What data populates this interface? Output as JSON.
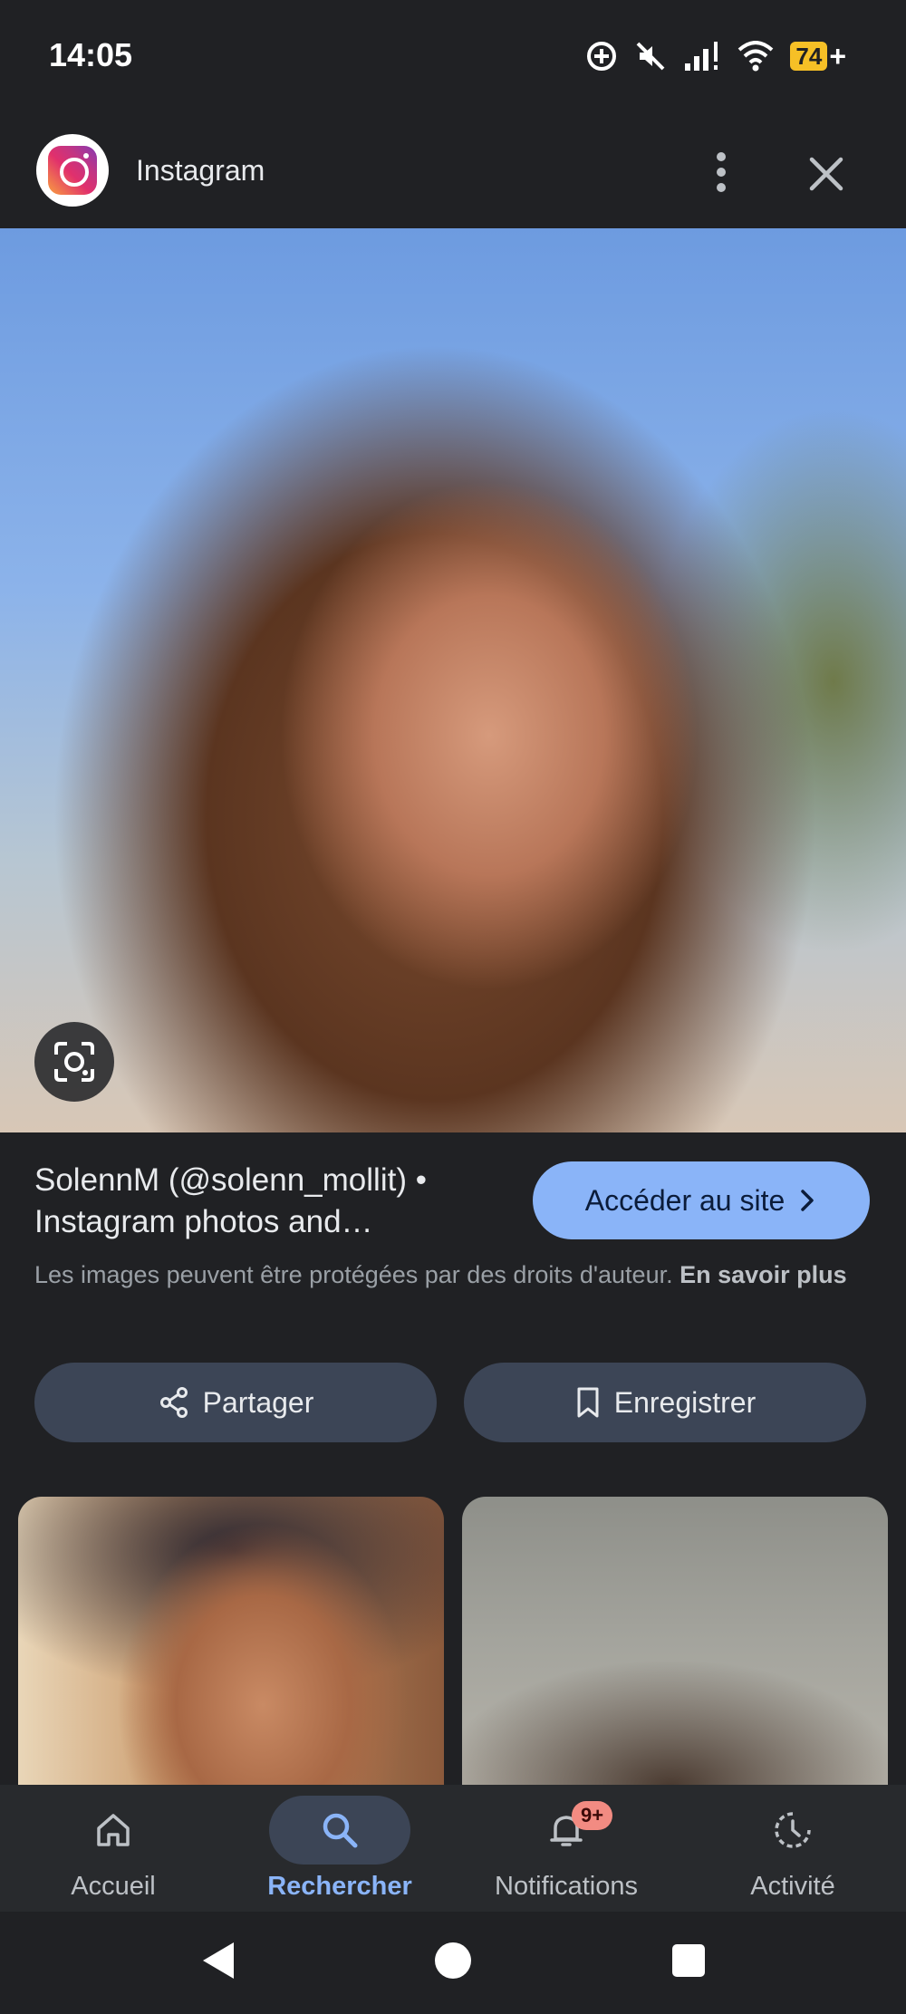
{
  "status_bar": {
    "time": "14:05",
    "battery": "74",
    "icons": [
      "data-saver-icon",
      "mute-icon",
      "signal-icon",
      "wifi-icon",
      "battery-charging-icon"
    ]
  },
  "header": {
    "app_name": "Instagram",
    "icons": [
      "instagram-logo",
      "more-vert-icon",
      "close-icon"
    ]
  },
  "result": {
    "title": "SolennM (@solenn_mollit) • Instagram photos and…",
    "visit_button": "Accéder au site",
    "copyright_text": "Les images peuvent être protégées par des droits d'auteur.",
    "learn_more": "En savoir plus"
  },
  "actions": {
    "share": "Partager",
    "save": "Enregistrer"
  },
  "bottom_nav": {
    "items": [
      {
        "label": "Accueil",
        "icon": "home-icon",
        "active": false
      },
      {
        "label": "Rechercher",
        "icon": "search-icon",
        "active": true
      },
      {
        "label": "Notifications",
        "icon": "bell-icon",
        "active": false,
        "badge": "9+"
      },
      {
        "label": "Activité",
        "icon": "activity-icon",
        "active": false
      }
    ]
  },
  "colors": {
    "background": "#202124",
    "accent": "#8ab4f8",
    "button": "#3c4556",
    "badge": "#f28b82",
    "battery": "#f6c026"
  }
}
